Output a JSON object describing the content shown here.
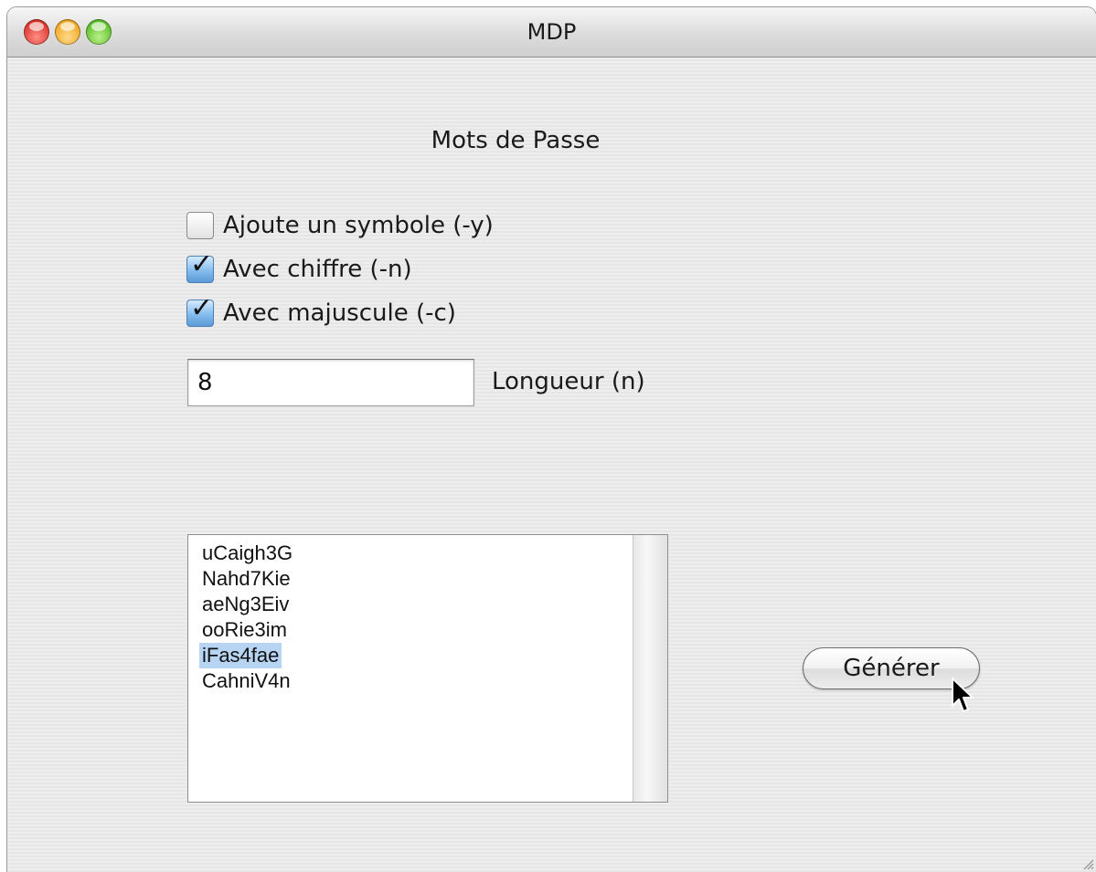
{
  "window": {
    "title": "MDP"
  },
  "form": {
    "heading": "Mots de Passe",
    "options": [
      {
        "label": "Ajoute un symbole (-y)",
        "checked": false
      },
      {
        "label": "Avec chiffre (-n)",
        "checked": true
      },
      {
        "label": "Avec majuscule (-c)",
        "checked": true
      }
    ],
    "length_value": "8",
    "length_label": "Longueur (n)"
  },
  "results": {
    "items": [
      "uCaigh3G",
      "Nahd7Kie",
      "aeNg3Eiv",
      "ooRie3im",
      "iFas4fae",
      "CahniV4n"
    ],
    "selected": "iFas4fae"
  },
  "actions": {
    "generate_label": "Générer"
  },
  "icons": {
    "close": "close-icon",
    "minimize": "minimize-icon",
    "zoom": "zoom-icon",
    "checkmark": "checkmark-icon",
    "cursor": "arrow-cursor-icon",
    "resize": "resize-grip-icon"
  },
  "colors": {
    "selection": "#b7d4f2",
    "checkbox_checked": "#7fb8ec"
  }
}
